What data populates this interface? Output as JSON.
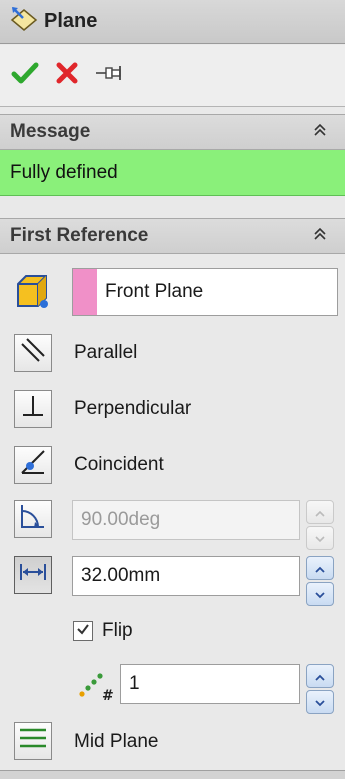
{
  "panel": {
    "title": "Plane"
  },
  "actions": {
    "ok_icon": "checkmark-icon",
    "cancel_icon": "x-icon",
    "pin_icon": "pushpin-icon"
  },
  "message": {
    "header": "Message",
    "text": "Fully defined",
    "status_color": "#8af07a"
  },
  "first_reference": {
    "header": "First Reference",
    "selection": "Front Plane",
    "selection_color": "#f090c8",
    "options": {
      "parallel": "Parallel",
      "perpendicular": "Perpendicular",
      "coincident": "Coincident",
      "mid_plane": "Mid Plane"
    },
    "angle": {
      "value": "90.00deg",
      "enabled": false
    },
    "distance": {
      "value": "32.00mm",
      "enabled": true
    },
    "flip": {
      "label": "Flip",
      "checked": true
    },
    "instances": {
      "value": "1"
    }
  }
}
